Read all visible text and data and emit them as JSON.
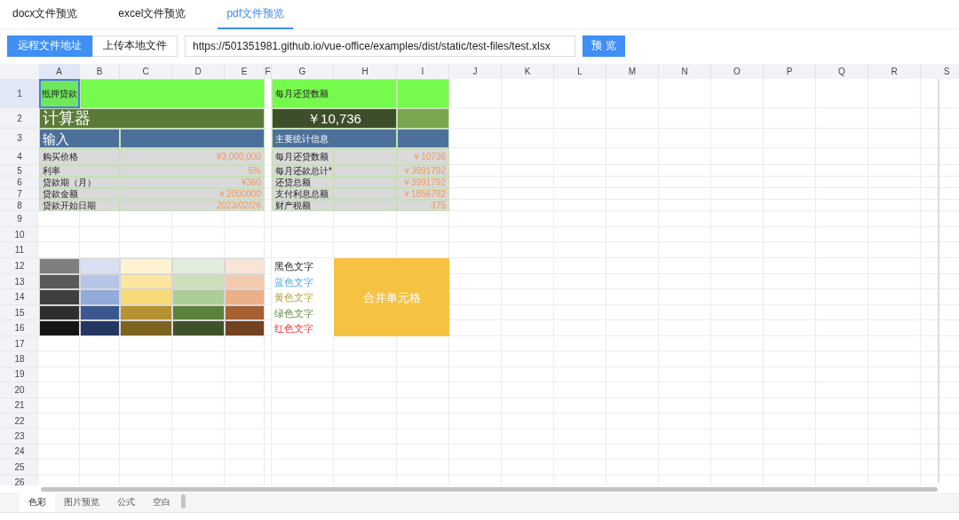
{
  "tabs": [
    {
      "label": "docx文件预览",
      "selected": false
    },
    {
      "label": "excel文件预览",
      "selected": false
    },
    {
      "label": "pdf文件预览",
      "selected": true
    }
  ],
  "source_switch": [
    {
      "label": "远程文件地址",
      "selected": true
    },
    {
      "label": "上传本地文件",
      "selected": false
    }
  ],
  "url_field": {
    "value": "https://501351981.github.io/vue-office/examples/dist/static/test-files/test.xlsx"
  },
  "preview_button": "预 览",
  "sheet": {
    "columns": [
      {
        "label": "A",
        "selected": true
      },
      {
        "label": "B",
        "selected": false
      },
      {
        "label": "C",
        "selected": false
      },
      {
        "label": "D",
        "selected": false
      },
      {
        "label": "E",
        "selected": false
      },
      {
        "label": "F",
        "selected": false
      },
      {
        "label": "G",
        "selected": false
      },
      {
        "label": "H",
        "selected": false
      },
      {
        "label": "I",
        "selected": false
      },
      {
        "label": "J",
        "selected": false
      },
      {
        "label": "K",
        "selected": false
      },
      {
        "label": "L",
        "selected": false
      },
      {
        "label": "M",
        "selected": false
      },
      {
        "label": "N",
        "selected": false
      },
      {
        "label": "O",
        "selected": false
      },
      {
        "label": "P",
        "selected": false
      },
      {
        "label": "Q",
        "selected": false
      },
      {
        "label": "R",
        "selected": false
      },
      {
        "label": "S",
        "selected": false
      }
    ],
    "rows": [
      {
        "label": "1",
        "selected": true,
        "cells": [
          {
            "kind": "label",
            "text": "抵押贷款",
            "color": "#6ee85a",
            "selected": true
          },
          {
            "kind": "blank",
            "colspan": 4,
            "color": "#76fa4d",
            "selected": false
          },
          {
            "kind": "label",
            "colspan": 2,
            "text": "每月还贷数额",
            "color": "#76fa4d",
            "selected": false
          },
          {
            "kind": "blank",
            "color": "#76fa4d",
            "selected": false
          }
        ]
      },
      {
        "label": "2",
        "selected": false,
        "cells": [
          {
            "kind": "title",
            "colspan": 5,
            "text": "计算器",
            "color": "#5b7a37",
            "selected": false
          },
          {
            "kind": "big_value",
            "colspan": 2,
            "text": "￥10,736",
            "color": "#3d4f2a",
            "selected": false
          },
          {
            "kind": "blank",
            "color": "#7ba54f",
            "selected": false
          }
        ]
      },
      {
        "label": "3",
        "selected": false,
        "cells": [
          {
            "kind": "heading",
            "colspan": 2,
            "text": "输入",
            "color": "#4d709b",
            "selected": false
          },
          {
            "kind": "blank",
            "colspan": 3,
            "color": "#4d709b",
            "selected": false
          },
          {
            "kind": "subheading",
            "colspan": 2,
            "text": "主要统计信息",
            "color": "#4d709b",
            "selected": false
          },
          {
            "kind": "blank",
            "color": "#4d709b",
            "selected": false
          }
        ]
      },
      {
        "label": "4",
        "selected": false,
        "cells": [
          {
            "kind": "label",
            "colspan": 2,
            "text": "购买价格",
            "color": "#d9d9d9",
            "selected": false
          },
          {
            "kind": "value",
            "colspan": 3,
            "text": "¥3,000,000",
            "color": "#d9d9d9",
            "selected": false
          },
          {
            "kind": "label",
            "text": "每月还贷数额",
            "color": "#d9d9d9",
            "selected": false
          },
          {
            "kind": "blank",
            "color": "#d9d9d9",
            "selected": false
          },
          {
            "kind": "value",
            "text": "￥10736",
            "color": "#d9d9d9",
            "selected": false
          }
        ]
      },
      {
        "label": "5",
        "selected": false,
        "cells": [
          {
            "kind": "label",
            "colspan": 2,
            "text": "利率",
            "color": "#d9d9d9",
            "selected": false
          },
          {
            "kind": "value",
            "colspan": 3,
            "text": "5%",
            "color": "#d9d9d9",
            "selected": false
          },
          {
            "kind": "label",
            "text": "每月还款总计*",
            "color": "#d9d9d9",
            "selected": false
          },
          {
            "kind": "blank",
            "color": "#d9d9d9",
            "selected": false
          },
          {
            "kind": "value",
            "text": "￥3991792",
            "color": "#d9d9d9",
            "selected": false
          }
        ]
      },
      {
        "label": "6",
        "selected": false,
        "cells": [
          {
            "kind": "label",
            "colspan": 2,
            "text": "贷款期（月）",
            "color": "#d9d9d9",
            "selected": false
          },
          {
            "kind": "value",
            "colspan": 3,
            "text": "¥360",
            "color": "#d9d9d9",
            "selected": false
          },
          {
            "kind": "label",
            "text": "还贷总额",
            "color": "#d9d9d9",
            "selected": false
          },
          {
            "kind": "blank",
            "color": "#d9d9d9",
            "selected": false
          },
          {
            "kind": "value",
            "text": "￥3991792",
            "color": "#d9d9d9",
            "selected": false
          }
        ]
      },
      {
        "label": "7",
        "selected": false,
        "cells": [
          {
            "kind": "label",
            "colspan": 2,
            "text": "贷款金额",
            "color": "#d9d9d9",
            "selected": false
          },
          {
            "kind": "value",
            "colspan": 3,
            "text": "￥2000000",
            "color": "#d9d9d9",
            "selected": false
          },
          {
            "kind": "label",
            "text": "支付利息总额",
            "color": "#d9d9d9",
            "selected": false
          },
          {
            "kind": "blank",
            "color": "#d9d9d9",
            "selected": false
          },
          {
            "kind": "value",
            "text": "￥1856792",
            "color": "#d9d9d9",
            "selected": false
          }
        ]
      },
      {
        "label": "8",
        "selected": false,
        "cells": [
          {
            "kind": "label",
            "colspan": 2,
            "text": "贷款开始日期",
            "color": "#d9d9d9",
            "selected": false
          },
          {
            "kind": "value",
            "colspan": 3,
            "text": "2023/02/26",
            "color": "#d9d9d9",
            "selected": false
          },
          {
            "kind": "label",
            "text": "财产税额",
            "color": "#d9d9d9",
            "selected": false
          },
          {
            "kind": "blank",
            "color": "#d9d9d9",
            "selected": false
          },
          {
            "kind": "value",
            "text": "375",
            "color": "#d9d9d9",
            "selected": false
          }
        ]
      },
      {
        "label": "9",
        "selected": false
      },
      {
        "label": "10",
        "selected": false
      },
      {
        "label": "11",
        "selected": false
      },
      {
        "label": "12",
        "selected": false,
        "cells": [
          {
            "kind": "swatch",
            "color": "#7f7f7f",
            "selected": false
          },
          {
            "kind": "swatch",
            "color": "#dadff2",
            "selected": false
          },
          {
            "kind": "swatch",
            "color": "#fef2d0",
            "selected": false
          },
          {
            "kind": "swatch",
            "color": "#e3eddb",
            "selected": false
          },
          {
            "kind": "swatch",
            "color": "#f9e5d8",
            "selected": false
          },
          {
            "kind": "colored_text",
            "text": "黑色文字",
            "color": "#222222",
            "selected": false
          },
          {
            "kind": "merged",
            "colspan": 2,
            "rowspan": 5,
            "text": "合并单元格",
            "color": "#f5c242",
            "selected": false
          }
        ]
      },
      {
        "label": "13",
        "selected": false,
        "cells": [
          {
            "kind": "swatch",
            "color": "#595959",
            "selected": false
          },
          {
            "kind": "swatch",
            "color": "#b6c5e6",
            "selected": false
          },
          {
            "kind": "swatch",
            "color": "#fbe59f",
            "selected": false
          },
          {
            "kind": "swatch",
            "color": "#cbdfba",
            "selected": false
          },
          {
            "kind": "swatch",
            "color": "#f2cbae",
            "selected": false
          },
          {
            "kind": "colored_text",
            "text": "蓝色文字",
            "color": "#4aa8e6",
            "selected": false
          }
        ]
      },
      {
        "label": "14",
        "selected": false,
        "cells": [
          {
            "kind": "swatch",
            "color": "#3f3f3f",
            "selected": false
          },
          {
            "kind": "swatch",
            "color": "#93abd9",
            "selected": false
          },
          {
            "kind": "swatch",
            "color": "#f8d978",
            "selected": false
          },
          {
            "kind": "swatch",
            "color": "#adcd96",
            "selected": false
          },
          {
            "kind": "swatch",
            "color": "#ebb089",
            "selected": false
          },
          {
            "kind": "colored_text",
            "text": "黄色文字",
            "color": "#b89d3a",
            "selected": false
          }
        ]
      },
      {
        "label": "15",
        "selected": false,
        "cells": [
          {
            "kind": "swatch",
            "color": "#2e2e2e",
            "selected": false
          },
          {
            "kind": "swatch",
            "color": "#3a578f",
            "selected": false
          },
          {
            "kind": "swatch",
            "color": "#b79230",
            "selected": false
          },
          {
            "kind": "swatch",
            "color": "#5c813e",
            "selected": false
          },
          {
            "kind": "swatch",
            "color": "#a56132",
            "selected": false
          },
          {
            "kind": "colored_text",
            "text": "绿色文字",
            "color": "#5b8a3a",
            "selected": false
          }
        ]
      },
      {
        "label": "16",
        "selected": false,
        "cells": [
          {
            "kind": "swatch",
            "color": "#151515",
            "selected": false
          },
          {
            "kind": "swatch",
            "color": "#243761",
            "selected": false
          },
          {
            "kind": "swatch",
            "color": "#7c631e",
            "selected": false
          },
          {
            "kind": "swatch",
            "color": "#3e5329",
            "selected": false
          },
          {
            "kind": "swatch",
            "color": "#724221",
            "selected": false
          },
          {
            "kind": "colored_text",
            "text": "红色文字",
            "color": "#ef3030",
            "selected": false
          }
        ]
      },
      {
        "label": "17",
        "selected": false
      },
      {
        "label": "18",
        "selected": false
      },
      {
        "label": "19",
        "selected": false
      },
      {
        "label": "20",
        "selected": false
      },
      {
        "label": "21",
        "selected": false
      },
      {
        "label": "22",
        "selected": false
      },
      {
        "label": "23",
        "selected": false
      },
      {
        "label": "24",
        "selected": false
      },
      {
        "label": "25",
        "selected": false
      },
      {
        "label": "26",
        "selected": false
      }
    ]
  },
  "sheet_tabs": [
    {
      "label": "色彩",
      "selected": true
    },
    {
      "label": "图片预览",
      "selected": false
    },
    {
      "label": "公式",
      "selected": false
    },
    {
      "label": "空白",
      "selected": false
    }
  ]
}
